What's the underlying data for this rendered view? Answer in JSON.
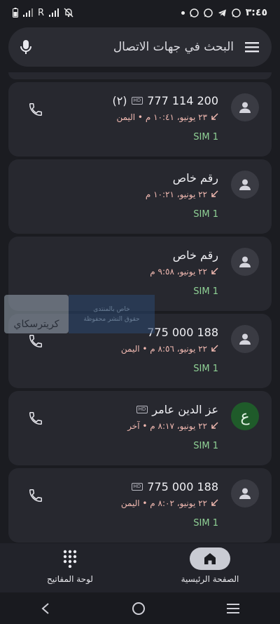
{
  "status_bar": {
    "time": "٣:٤٥",
    "carrier": "R",
    "icons": [
      "notification-dot-icon",
      "whatsapp-icon",
      "whatsapp-icon",
      "telegram-icon",
      "whatsapp-icon",
      "battery-icon",
      "signal-icon",
      "signal-icon",
      "mute-icon"
    ]
  },
  "search": {
    "placeholder": "البحث في جهات الاتصال"
  },
  "calls": [
    {
      "name": "777 114 200",
      "count": "(٢)",
      "hd": "HD",
      "detail": "٢٣ يونيو، ١٠:٤١ م • اليمن",
      "sim": "SIM 1",
      "avatar": "person",
      "callable": true
    },
    {
      "name": "رقم خاص",
      "count": "",
      "hd": "",
      "detail": "٢٢ يونيو، ١٠:٢١ م",
      "sim": "SIM 1",
      "avatar": "person",
      "callable": false
    },
    {
      "name": "رقم خاص",
      "count": "",
      "hd": "",
      "detail": "٢٢ يونيو، ٩:٥٨ م",
      "sim": "SIM 1",
      "avatar": "person",
      "callable": false
    },
    {
      "name": "775 000 188",
      "count": "",
      "hd": "",
      "detail": "٢٢ يونيو، ٨:٥٦ م • اليمن",
      "sim": "SIM 1",
      "avatar": "person",
      "callable": true
    },
    {
      "name": "عز الدين عامر",
      "count": "",
      "hd": "HD",
      "detail": "٢٢ يونيو، ٨:١٧ م • آخر",
      "sim": "SIM 1",
      "avatar": "ع",
      "callable": true
    },
    {
      "name": "775 000 188",
      "count": "",
      "hd": "HD",
      "detail": "٢٢ يونيو، ٨:٠٢ م • اليمن",
      "sim": "SIM 1",
      "avatar": "person",
      "callable": true
    }
  ],
  "watermark": {
    "brand": "كريترسكاي",
    "line1": "خاص بالمنتدى",
    "line2": "حقوق النشر محفوظة"
  },
  "bottom_nav": {
    "home_label": "الصفحة الرئيسية",
    "keypad_label": "لوحة المفاتيح"
  },
  "colors": {
    "background": "#1b1c21",
    "card": "#27282f",
    "sim": "#8fd195",
    "missed": "#f1b9b1",
    "avatar_letter": "#1f5b2a"
  }
}
